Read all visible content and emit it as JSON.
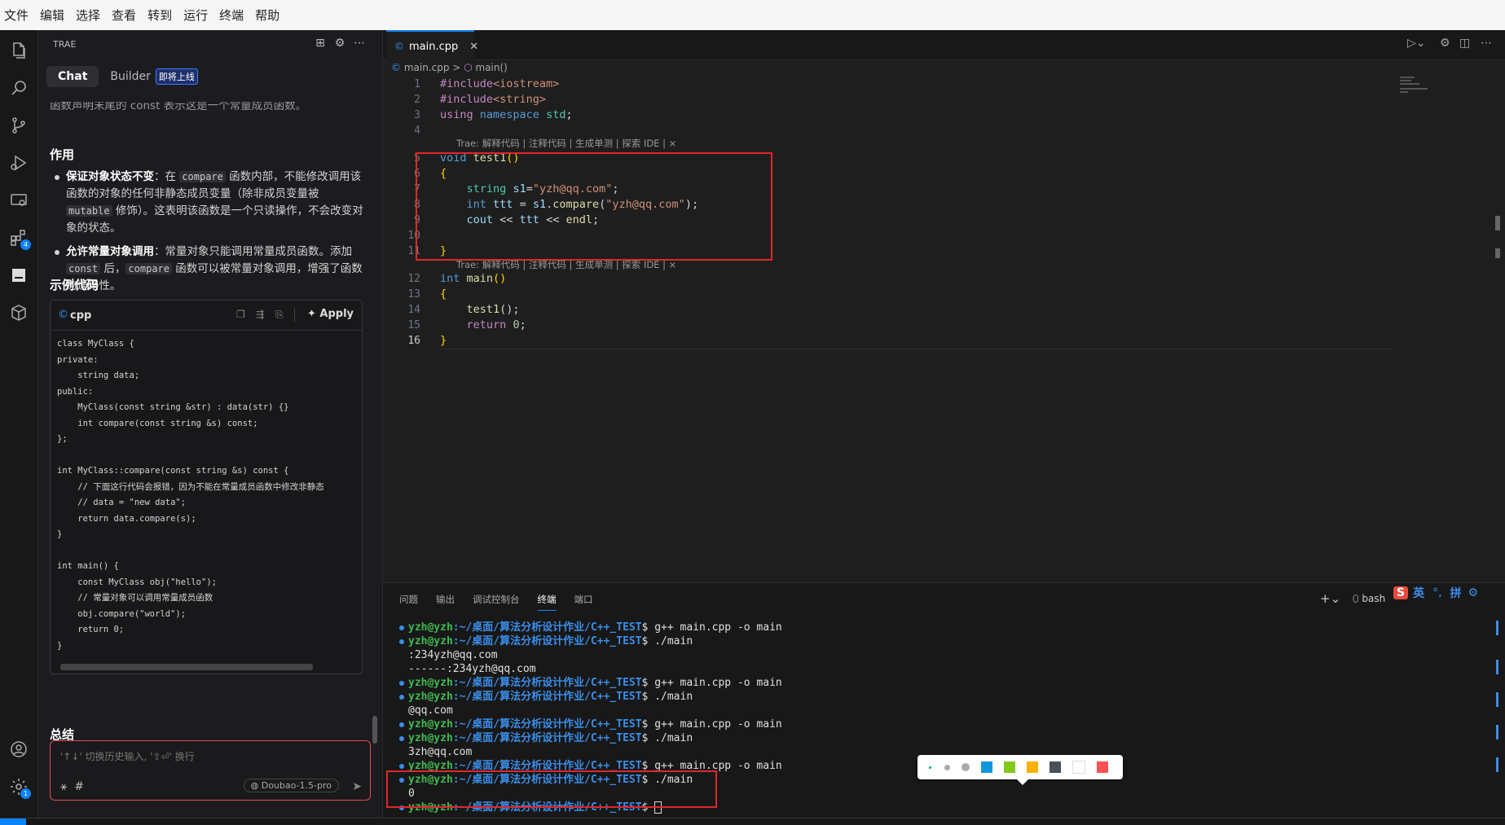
{
  "menu": [
    "文件",
    "编辑",
    "选择",
    "查看",
    "转到",
    "运行",
    "终端",
    "帮助"
  ],
  "chat": {
    "header_title": "TRAE",
    "tabs": [
      {
        "label": "Chat"
      },
      {
        "label": "Builder"
      }
    ],
    "builder_badge": "即将上线",
    "truncated_text": "函数声明末尾的 const 表示这是一个常量成员函数。",
    "section_role": "作用",
    "bullet1_title": "保证对象状态不变",
    "bullet1_text_a": "：在 ",
    "bullet1_code": "compare",
    "bullet1_text_b": " 函数内部，不能修改调用该函数的对象的任何非静态成员变量（除非成员变量被 ",
    "bullet1_code2": "mutable",
    "bullet1_text_c": " 修饰）。这表明该函数是一个只读操作，不会改变对象的状态。",
    "bullet2_title": "允许常量对象调用",
    "bullet2_text_a": "：常量对象只能调用常量成员函数。添加 ",
    "bullet2_code": "const",
    "bullet2_text_b": " 后，",
    "bullet2_code2": "compare",
    "bullet2_text_c": " 函数可以被常量对象调用，增强了函数的通用性。",
    "section_example": "示例代码",
    "code_lang": "cpp",
    "apply_label": "Apply",
    "code_text": "class MyClass {\nprivate:\n    string data;\npublic:\n    MyClass(const string &str) : data(str) {}\n    int compare(const string &s) const;\n};\n\nint MyClass::compare(const string &s) const {\n    // 下面这行代码会报错，因为不能在常量成员函数中修改非静态\n    // data = \"new data\";\n    return data.compare(s);\n}\n\nint main() {\n    const MyClass obj(\"hello\");\n    // 常量对象可以调用常量成员函数\n    obj.compare(\"world\");\n    return 0;\n}",
    "section_summary": "总结",
    "input_placeholder": "'↑↓' 切换历史输入, '⇧⏎' 换行",
    "model_label": "Doubao-1.5-pro"
  },
  "editor": {
    "tab_label": "main.cpp",
    "breadcrumb_file": "main.cpp",
    "breadcrumb_sep": ">",
    "breadcrumb_symbol": "main()",
    "codelens": "Trae: 解释代码 | 注释代码 | 生成单测 | 探索 IDE | ×",
    "line_numbers": [
      "1",
      "2",
      "3",
      "4",
      "5",
      "6",
      "7",
      "8",
      "9",
      "10",
      "11",
      "12",
      "13",
      "14",
      "15",
      "16"
    ]
  },
  "panel": {
    "tabs": [
      {
        "label": "问题"
      },
      {
        "label": "输出"
      },
      {
        "label": "调试控制台"
      },
      {
        "label": "终端"
      },
      {
        "label": "端口"
      }
    ],
    "shell_label": "bash",
    "prompt_user": "yzh@yzh",
    "prompt_path": ":~/桌面/算法分析设计作业/C++_TEST",
    "terminal": [
      {
        "type": "prompt",
        "cmd": "$ g++ main.cpp -o main"
      },
      {
        "type": "prompt",
        "cmd": "$ ./main"
      },
      {
        "type": "out",
        "text": ":234yzh@qq.com"
      },
      {
        "type": "out",
        "text": "------:234yzh@qq.com"
      },
      {
        "type": "prompt",
        "cmd": "$ g++ main.cpp -o main"
      },
      {
        "type": "prompt",
        "cmd": "$ ./main"
      },
      {
        "type": "out",
        "text": "@qq.com"
      },
      {
        "type": "prompt",
        "cmd": "$ g++ main.cpp -o main"
      },
      {
        "type": "prompt",
        "cmd": "$ ./main"
      },
      {
        "type": "out",
        "text": "3zh@qq.com"
      },
      {
        "type": "prompt",
        "cmd": "$ g++ main.cpp -o main"
      },
      {
        "type": "prompt",
        "cmd": "$ ./main"
      },
      {
        "type": "out",
        "text": "0"
      },
      {
        "type": "prompt",
        "cmd": "$ "
      }
    ]
  },
  "ime": {
    "lang": "英",
    "mode": "拼"
  },
  "palette_colors": [
    "#1296db",
    "#82c91e",
    "#fab005",
    "#495057",
    "#ffffff",
    "#fa5252"
  ],
  "colors": {
    "accent": "#0a84ff",
    "highlight_box": "#e0262b"
  }
}
